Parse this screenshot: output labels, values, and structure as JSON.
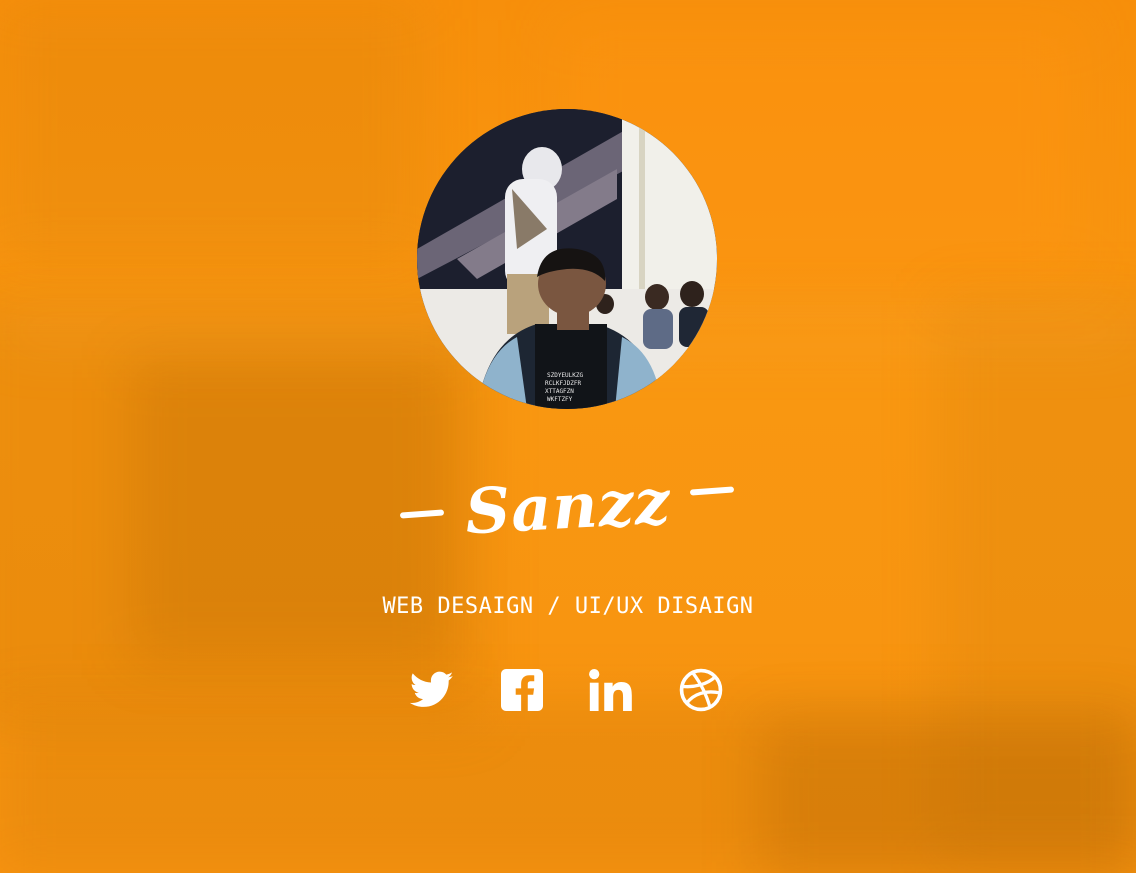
{
  "profile": {
    "name": "Sanzz",
    "tagline": "WEB DESAIGN / UI/UX DISAIGN",
    "avatar_icon": "profile-photo"
  },
  "social": [
    {
      "name": "twitter",
      "icon": "twitter-icon"
    },
    {
      "name": "facebook",
      "icon": "facebook-icon"
    },
    {
      "name": "linkedin",
      "icon": "linkedin-icon"
    },
    {
      "name": "dribbble",
      "icon": "dribbble-icon"
    }
  ],
  "colors": {
    "background": "#f7920f",
    "text": "#ffffff"
  }
}
